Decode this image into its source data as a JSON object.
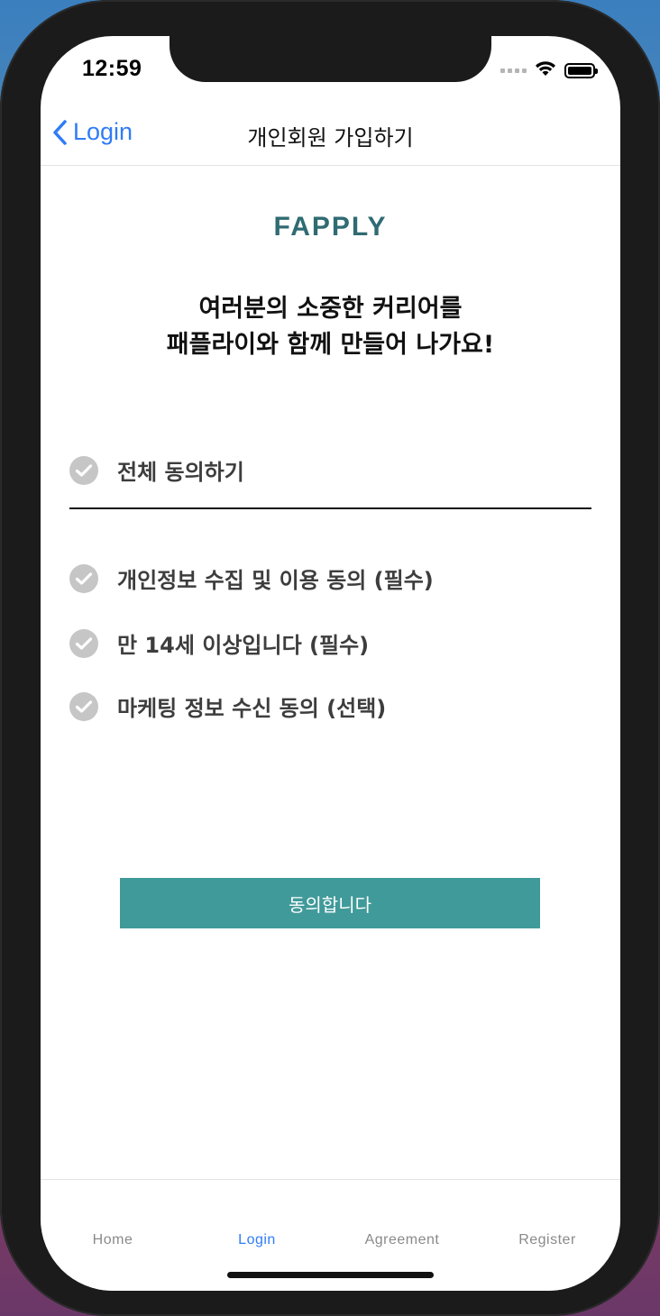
{
  "status_bar": {
    "time": "12:59"
  },
  "navbar": {
    "back_label": "Login",
    "title": "개인회원 가입하기"
  },
  "logo": {
    "text": "FAPPLY"
  },
  "headline": {
    "line1": "여러분의 소중한 커리어를",
    "line2": "패플라이와 함께 만들어 나가요!"
  },
  "agreements": {
    "all": "전체 동의하기",
    "items": [
      {
        "label": "개인정보 수집 및 이용 동의 (필수)"
      },
      {
        "label": "만 14세 이상입니다 (필수)"
      },
      {
        "label": "마케팅 정보 수신 동의 (선택)"
      }
    ]
  },
  "agree_button": {
    "label": "동의합니다"
  },
  "tabbar": {
    "tabs": [
      {
        "label": "Home"
      },
      {
        "label": "Login"
      },
      {
        "label": "Agreement"
      },
      {
        "label": "Register"
      }
    ],
    "active": "Login"
  },
  "colors": {
    "accent": "#419a9a",
    "ios_blue": "#2f7cf6",
    "check_gray": "#c6c6c6",
    "logo_teal": "#2f6b72"
  },
  "icons": {
    "back": "chevron-left-icon",
    "check": "check-circle-icon",
    "wifi": "wifi-icon",
    "battery": "battery-icon",
    "signal": "signal-icon"
  }
}
